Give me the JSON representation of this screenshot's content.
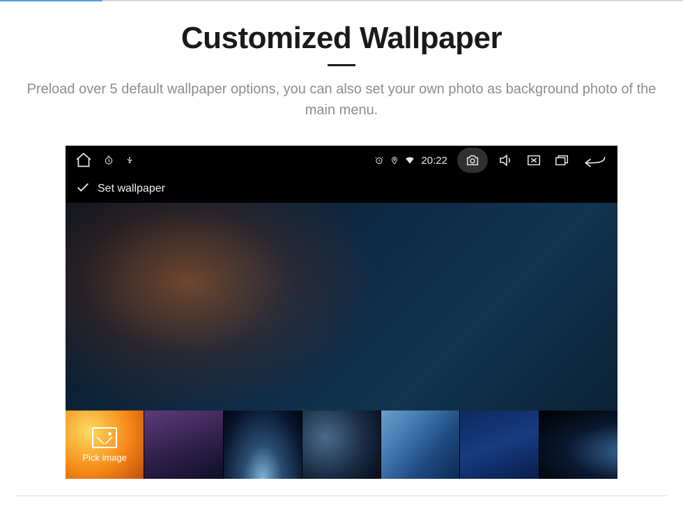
{
  "page": {
    "title": "Customized Wallpaper",
    "subtitle": "Preload over 5 default wallpaper options, you can also set your own photo as background photo of the main menu."
  },
  "status_bar": {
    "clock": "20:22"
  },
  "sub_bar": {
    "label": "Set wallpaper"
  },
  "thumbnails": {
    "pick_label": "Pick image"
  }
}
